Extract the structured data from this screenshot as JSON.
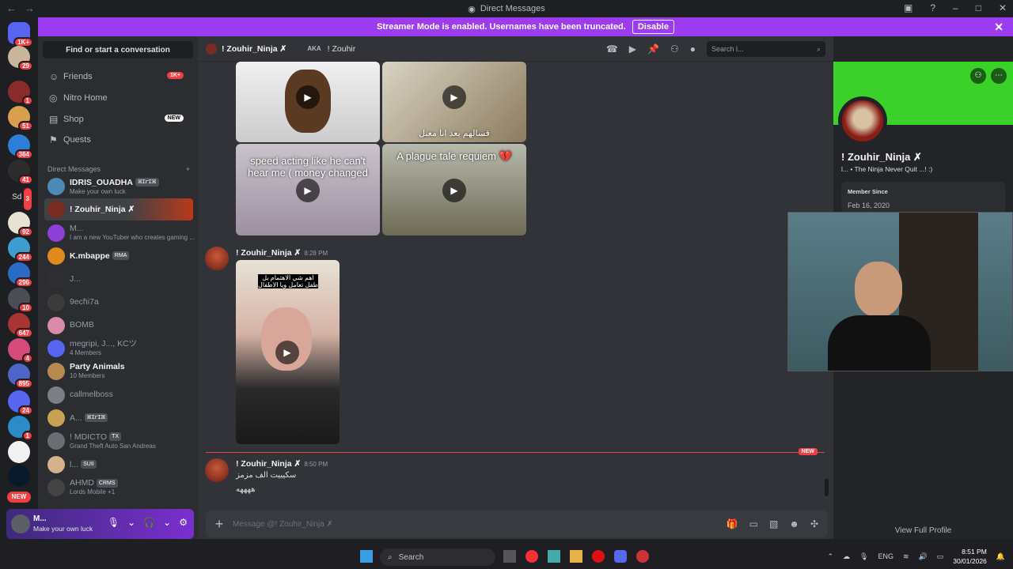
{
  "window": {
    "title": "Direct Messages"
  },
  "banner": {
    "text": "Streamer Mode is enabled. Usernames have been truncated.",
    "button": "Disable"
  },
  "guild_badges": [
    "1K+",
    "29",
    "1",
    "51",
    "364",
    "41",
    "Sdh",
    "3",
    "92",
    "244",
    "296",
    "10",
    "647",
    "4",
    "895",
    "24",
    "1",
    "NEW"
  ],
  "sidebar": {
    "find": "Find or start a conversation",
    "nav": [
      {
        "label": "Friends",
        "badge": "1K+"
      },
      {
        "label": "Nitro Home",
        "badge": ""
      },
      {
        "label": "Shop",
        "badge": "NEW"
      },
      {
        "label": "Quests",
        "badge": ""
      }
    ],
    "dm_header": "Direct Messages",
    "dms": [
      {
        "name": "IDRIS_OUADHA",
        "tag": "ꕤꞮꭈꞮꕤ",
        "sub": "Make your own luck",
        "color": "#4e8ab8"
      },
      {
        "name": "! Zouhir_Ninja ✗",
        "tag": "",
        "sub": "",
        "color": "#7a2b22"
      },
      {
        "name": "M...",
        "tag": "",
        "sub": "I am a new YouTuber who creates gaming ...",
        "color": "#8e3fd6"
      },
      {
        "name": "K.mbappe",
        "tag": "RMA",
        "sub": "",
        "color": "#e08a1e"
      },
      {
        "name": "J...",
        "tag": "",
        "sub": "",
        "color": "#2f2f35"
      },
      {
        "name": "9ech̄i7a",
        "tag": "",
        "sub": "",
        "color": "#3b3b3b"
      },
      {
        "name": "BOMB",
        "tag": "",
        "sub": "",
        "color": "#d98aa8"
      },
      {
        "name": "megripi, J..., KCツ",
        "tag": "",
        "sub": "4 Members",
        "color": "#5865f2"
      },
      {
        "name": "Party Animals",
        "tag": "",
        "sub": "10 Members",
        "color": "#b58a4e"
      },
      {
        "name": "callmelboss",
        "tag": "",
        "sub": "",
        "color": "#7c7f86"
      },
      {
        "name": "A...",
        "tag": "ꕤꞮꭈꞮꕤ",
        "sub": "",
        "color": "#c7a252"
      },
      {
        "name": "! MDICTO",
        "tag": "TX",
        "sub": "Grand Theft Auto San Andreas",
        "color": "#6a6d74"
      },
      {
        "name": "l...",
        "tag": "SUII",
        "sub": "",
        "color": "#d4b38c"
      },
      {
        "name": "AHMD",
        "tag": "CRMS",
        "sub": "Lords Mobile +1",
        "color": "#444"
      }
    ]
  },
  "user": {
    "name": "M...",
    "status": "Make your own luck"
  },
  "chat": {
    "recipient": "! Zouhir_Ninja ✗",
    "aka_label": "AKA",
    "aka_value": "! Zouhir",
    "search_placeholder": "Search l...",
    "captions": [
      "speed acting like he can't hear me ( money changed",
      "A plague tale requiem 💔",
      "قسالهم بعد انا معنل",
      "اهم شي الاهتمام بل طفل تعامل ويا الاطفال"
    ],
    "messages": [
      {
        "author": "! Zouhir_Ninja ✗",
        "time": "8:28 PM",
        "text": ""
      },
      {
        "author": "! Zouhir_Ninja ✗",
        "time": "8:50 PM",
        "text": "سكيبيت الف مزمز",
        "text2": "ههههه"
      }
    ],
    "new_label": "NEW",
    "composer_placeholder": "Message @! Zouhir_Ninja ✗"
  },
  "profile": {
    "name": "! Zouhir_Ninja ✗",
    "tagline": "l... • The Ninja Never Quit ...! :)",
    "member_since_label": "Member Since",
    "member_since": "Feb 16, 2020",
    "view_full": "View Full Profile",
    "banner_color": "#3ad12a"
  },
  "taskbar": {
    "search": "Search",
    "lang": "ENG",
    "time": "8:51 PM",
    "date": "30/01/2026"
  }
}
